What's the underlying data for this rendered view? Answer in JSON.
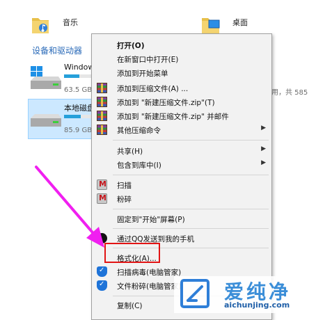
{
  "libraries": [
    {
      "label": "音乐"
    },
    {
      "label": "桌面"
    }
  ],
  "section_title": "设备和驱动器",
  "drives": [
    {
      "name": "Windows",
      "size_text": "63.5 GB",
      "extra_text": "用，共 585",
      "used_fraction": 0.55
    },
    {
      "name": "本地磁盘",
      "size_text": "85.9 GB",
      "used_fraction": 0.6
    }
  ],
  "menu": {
    "items": [
      {
        "label": "打开(O)",
        "bold": true
      },
      {
        "label": "在新窗口中打开(E)"
      },
      {
        "label": "添加到开始菜单"
      },
      {
        "label": "添加到压缩文件(A) ...",
        "icon": "winrar-icon"
      },
      {
        "label": "添加到 \"新建压缩文件.zip\"(T)",
        "icon": "winrar-icon"
      },
      {
        "label": "添加到 \"新建压缩文件.zip\" 并邮件",
        "icon": "winrar-icon"
      },
      {
        "label": "其他压缩命令",
        "icon": "winrar-icon",
        "submenu": true
      },
      {
        "label": "共享(H)",
        "submenu": true
      },
      {
        "label": "包含到库中(I)",
        "submenu": true
      },
      {
        "label": "扫描",
        "icon": "mcafee-icon"
      },
      {
        "label": "粉碎",
        "icon": "mcafee-icon"
      },
      {
        "label": "固定到\"开始\"屏幕(P)"
      },
      {
        "label": "通过QQ发送到我的手机",
        "icon": "qq-icon"
      },
      {
        "label": "格式化(A)..."
      },
      {
        "label": "扫描病毒(电脑管家)",
        "icon": "pc-manager-icon"
      },
      {
        "label": "文件粉碎(电脑管家)",
        "icon": "pc-manager-icon"
      },
      {
        "label": "复制(C)"
      }
    ],
    "arrow_glyph": "▶"
  },
  "watermark": {
    "cn": "爱纯净",
    "url": "aichunjing.com"
  },
  "colors": {
    "arrow": "#f01ff0",
    "highlight": "#e21414",
    "link": "#2a6ab8"
  }
}
